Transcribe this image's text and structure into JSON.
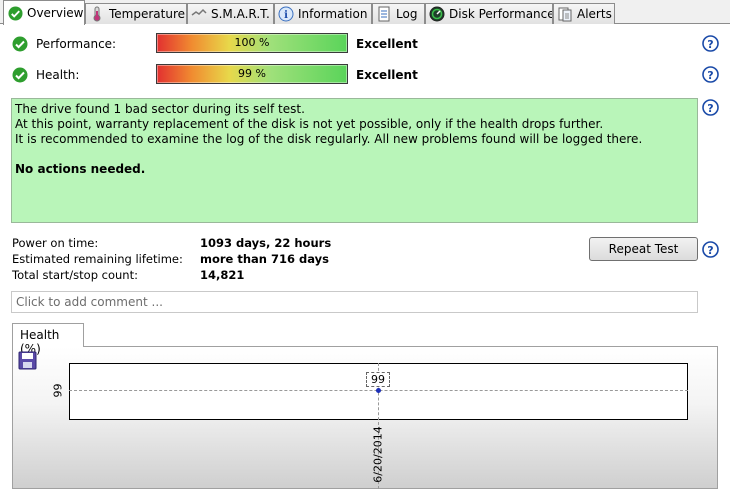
{
  "tabs": [
    {
      "label": "Overview",
      "icon": "green-check-icon",
      "active": true
    },
    {
      "label": "Temperature",
      "icon": "thermometer-icon",
      "active": false
    },
    {
      "label": "S.M.A.R.T.",
      "icon": "smart-drive-icon",
      "active": false
    },
    {
      "label": "Information",
      "icon": "info-icon",
      "active": false
    },
    {
      "label": "Log",
      "icon": "log-icon",
      "active": false
    },
    {
      "label": "Disk Performance",
      "icon": "performance-gauge-icon",
      "active": false
    },
    {
      "label": "Alerts",
      "icon": "alerts-document-icon",
      "active": false
    }
  ],
  "performance": {
    "label": "Performance:",
    "value": "100 %",
    "percent": 100,
    "status": "Excellent"
  },
  "health": {
    "label": "Health:",
    "value": "99 %",
    "percent": 99,
    "status": "Excellent"
  },
  "message": {
    "line1": "The drive found 1 bad sector during its self test.",
    "line2": "At this point, warranty replacement of the disk is not yet possible, only if the health drops further.",
    "line3": "It is recommended to examine the log of the disk regularly. All new problems found will be logged there.",
    "action": "No actions needed."
  },
  "stats": {
    "power_on_label": "Power on time:",
    "power_on_value": "1093 days, 22 hours",
    "remaining_label": "Estimated remaining lifetime:",
    "remaining_value": "more than 716 days",
    "startstop_label": "Total start/stop count:",
    "startstop_value": "14,821"
  },
  "repeat_test_label": "Repeat Test",
  "comment_placeholder": "Click to add comment ...",
  "chart_tab_label": "Health (%)",
  "colors": {
    "message_bg": "#b9f5b9",
    "point": "#1c2fb8",
    "check": "#2e9e2e",
    "help": "#1a4aa8"
  },
  "chart_data": {
    "type": "line",
    "x": [
      "6/20/2014"
    ],
    "series": [
      {
        "values": [
          99
        ]
      }
    ],
    "ytick_labels": [
      "99"
    ],
    "xtick_labels": [
      "6/20/2014"
    ],
    "data_labels": [
      "99"
    ],
    "grid": true
  }
}
